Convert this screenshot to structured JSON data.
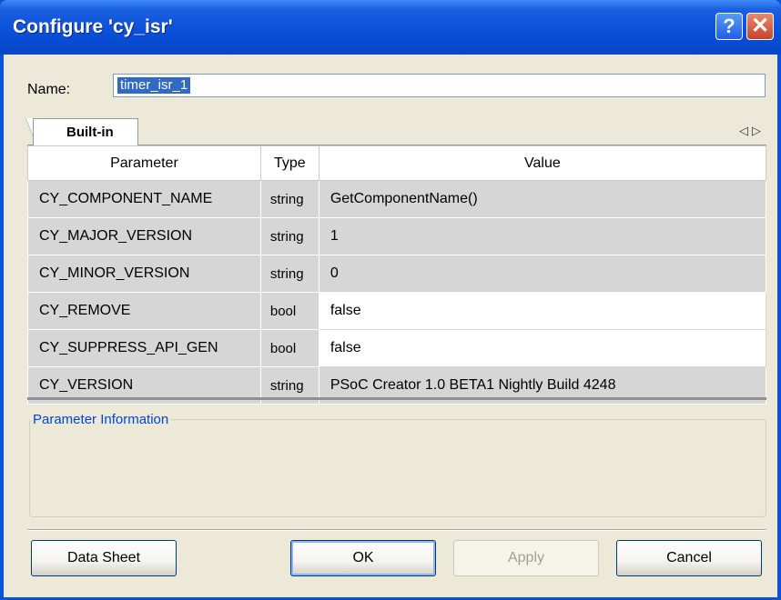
{
  "window": {
    "title": "Configure 'cy_isr'",
    "help_glyph": "?",
    "close_glyph": "✕"
  },
  "name_field": {
    "label": "Name:",
    "value": "timer_isr_1"
  },
  "tabs": [
    {
      "label": "Built-in",
      "active": true
    }
  ],
  "tab_nav": {
    "left": "◁",
    "right": "▷"
  },
  "table": {
    "headers": [
      "Parameter",
      "Type",
      "Value"
    ],
    "rows": [
      {
        "parameter": "CY_COMPONENT_NAME",
        "type": "string",
        "value": "GetComponentName()",
        "editable": false
      },
      {
        "parameter": "CY_MAJOR_VERSION",
        "type": "string",
        "value": "1",
        "editable": false
      },
      {
        "parameter": "CY_MINOR_VERSION",
        "type": "string",
        "value": "0",
        "editable": false
      },
      {
        "parameter": "CY_REMOVE",
        "type": "bool",
        "value": "false",
        "editable": true
      },
      {
        "parameter": "CY_SUPPRESS_API_GEN",
        "type": "bool",
        "value": "false",
        "editable": true
      },
      {
        "parameter": "CY_VERSION",
        "type": "string",
        "value": "PSoC Creator 1.0 BETA1 Nightly Build 4248",
        "editable": false
      }
    ]
  },
  "parameter_info": {
    "label": "Parameter Information"
  },
  "buttons": {
    "data_sheet": "Data Sheet",
    "ok": "OK",
    "apply": "Apply",
    "cancel": "Cancel"
  },
  "colors": {
    "titlebar": "#0a4fd8",
    "dialog_bg": "#ece9d8",
    "readonly_cell": "#d6d6d6",
    "groupbox_label": "#0046d5"
  }
}
